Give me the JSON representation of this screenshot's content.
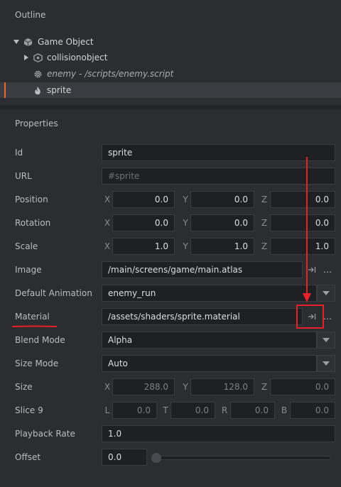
{
  "outline": {
    "title": "Outline",
    "items": [
      {
        "label": "Game Object"
      },
      {
        "label": "collisionobject"
      },
      {
        "label": "enemy - /scripts/enemy.script"
      },
      {
        "label": "sprite"
      }
    ]
  },
  "properties": {
    "title": "Properties",
    "id": {
      "label": "Id",
      "value": "sprite"
    },
    "url": {
      "label": "URL",
      "placeholder": "#sprite"
    },
    "position": {
      "label": "Position",
      "x": "0.0",
      "y": "0.0",
      "z": "0.0"
    },
    "rotation": {
      "label": "Rotation",
      "x": "0.0",
      "y": "0.0",
      "z": "0.0"
    },
    "scale": {
      "label": "Scale",
      "x": "1.0",
      "y": "1.0",
      "z": "1.0"
    },
    "image": {
      "label": "Image",
      "value": "/main/screens/game/main.atlas"
    },
    "default_animation": {
      "label": "Default Animation",
      "value": "enemy_run"
    },
    "material": {
      "label": "Material",
      "value": "/assets/shaders/sprite.material"
    },
    "blend_mode": {
      "label": "Blend Mode",
      "value": "Alpha"
    },
    "size_mode": {
      "label": "Size Mode",
      "value": "Auto"
    },
    "size": {
      "label": "Size",
      "x": "288.0",
      "y": "128.0",
      "z": "0.0"
    },
    "slice9": {
      "label": "Slice 9",
      "l": "0.0",
      "t": "0.0",
      "r": "0.0",
      "b": "0.0"
    },
    "playback_rate": {
      "label": "Playback Rate",
      "value": "1.0"
    },
    "offset": {
      "label": "Offset",
      "value": "0.0",
      "level": 0
    }
  },
  "axes": {
    "x": "X",
    "y": "Y",
    "z": "Z",
    "l": "L",
    "t": "T",
    "r": "R",
    "b": "B"
  },
  "buttons": {
    "more": "…"
  },
  "colors": {
    "accent": "#e56a2e",
    "annotation": "#e8202a"
  }
}
